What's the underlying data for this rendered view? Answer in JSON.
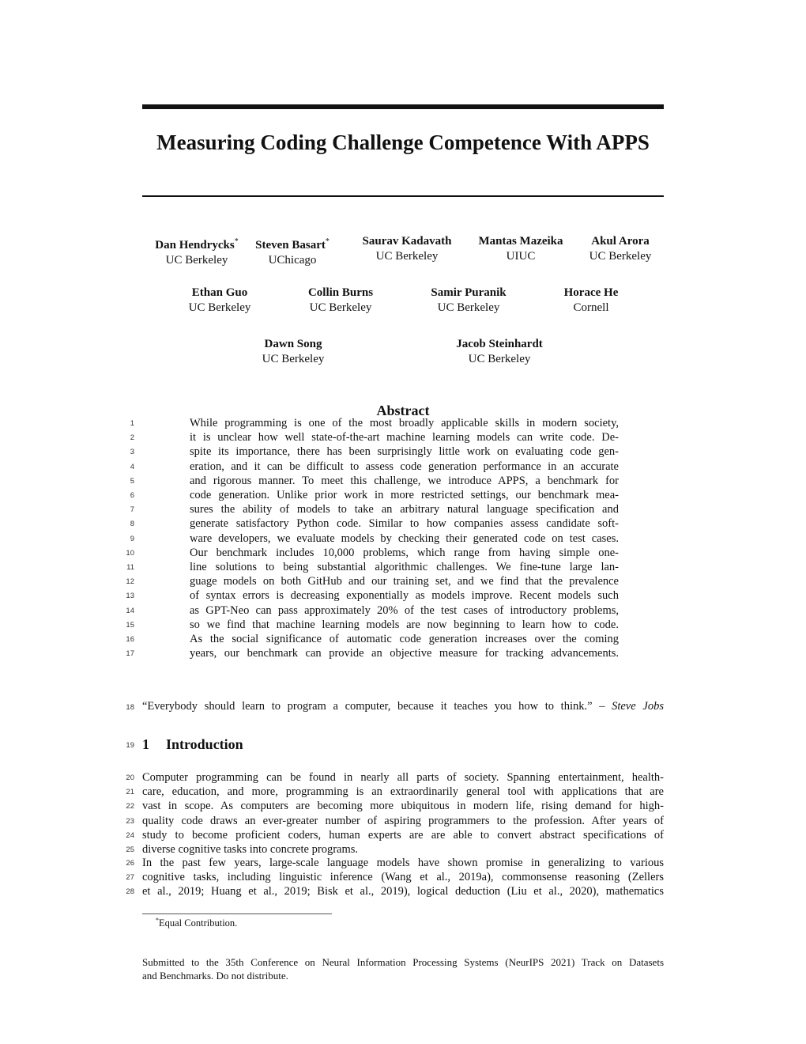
{
  "paper": {
    "title": "Measuring Coding Challenge Competence With APPS",
    "authors_row1": [
      {
        "name": "Dan Hendrycks",
        "mark": "*",
        "affiliation": "UC Berkeley"
      },
      {
        "name": "Steven Basart",
        "mark": "*",
        "affiliation": "UChicago"
      },
      {
        "name": "Saurav Kadavath",
        "mark": "",
        "affiliation": "UC Berkeley"
      },
      {
        "name": "Mantas Mazeika",
        "mark": "",
        "affiliation": "UIUC"
      },
      {
        "name": "Akul Arora",
        "mark": "",
        "affiliation": "UC Berkeley"
      }
    ],
    "authors_row2": [
      {
        "name": "Ethan Guo",
        "affiliation": "UC Berkeley"
      },
      {
        "name": "Collin Burns",
        "affiliation": "UC Berkeley"
      },
      {
        "name": "Samir Puranik",
        "affiliation": "UC Berkeley"
      },
      {
        "name": "Horace He",
        "affiliation": "Cornell"
      }
    ],
    "authors_row3": [
      {
        "name": "Dawn Song",
        "affiliation": "UC Berkeley"
      },
      {
        "name": "Jacob Steinhardt",
        "affiliation": "UC Berkeley"
      }
    ],
    "abstract_heading": "Abstract",
    "abstract_lines": [
      {
        "n": "1",
        "text": "While programming is one of the most broadly applicable skills in modern society,"
      },
      {
        "n": "2",
        "text": "it is unclear how well state-of-the-art machine learning models can write code. De-"
      },
      {
        "n": "3",
        "text": "spite its importance, there has been surprisingly little work on evaluating code gen-"
      },
      {
        "n": "4",
        "text": "eration, and it can be difficult to assess code generation performance in an accurate"
      },
      {
        "n": "5",
        "text": "and rigorous manner. To meet this challenge, we introduce APPS, a benchmark for"
      },
      {
        "n": "6",
        "text": "code generation. Unlike prior work in more restricted settings, our benchmark mea-"
      },
      {
        "n": "7",
        "text": "sures the ability of models to take an arbitrary natural language specification and"
      },
      {
        "n": "8",
        "text": "generate satisfactory Python code. Similar to how companies assess candidate soft-"
      },
      {
        "n": "9",
        "text": "ware developers, we evaluate models by checking their generated code on test cases."
      },
      {
        "n": "10",
        "text": "Our benchmark includes 10,000 problems, which range from having simple one-"
      },
      {
        "n": "11",
        "text": "line solutions to being substantial algorithmic challenges. We fine-tune large lan-"
      },
      {
        "n": "12",
        "text": "guage models on both GitHub and our training set, and we find that the prevalence"
      },
      {
        "n": "13",
        "text": "of syntax errors is decreasing exponentially as models improve. Recent models such"
      },
      {
        "n": "14",
        "text": "as GPT-Neo can pass approximately 20% of the test cases of introductory problems,"
      },
      {
        "n": "15",
        "text": "so we find that machine learning models are now beginning to learn how to code."
      },
      {
        "n": "16",
        "text": "As the social significance of automatic code generation increases over the coming"
      },
      {
        "n": "17",
        "text": "years, our benchmark can provide an objective measure for tracking advancements."
      }
    ],
    "quote": {
      "n": "18",
      "text": "“Everybody should learn to program a computer, because it teaches you how to think.” – ",
      "author": "Steve Jobs"
    },
    "section": {
      "n": "19",
      "number": "1",
      "title": "Introduction"
    },
    "intro_para1": [
      {
        "n": "20",
        "text": "Computer programming can be found in nearly all parts of society. Spanning entertainment, health-"
      },
      {
        "n": "21",
        "text": "care, education, and more, programming is an extraordinarily general tool with applications that are"
      },
      {
        "n": "22",
        "text": "vast in scope. As computers are becoming more ubiquitous in modern life, rising demand for high-"
      },
      {
        "n": "23",
        "text": "quality code draws an ever-greater number of aspiring programmers to the profession. After years of"
      },
      {
        "n": "24",
        "text": "study to become proficient coders, human experts are are able to convert abstract specifications of"
      },
      {
        "n": "25",
        "text": "diverse cognitive tasks into concrete programs."
      }
    ],
    "intro_para2": [
      {
        "n": "26",
        "text": "In the past few years, large-scale language models have shown promise in generalizing to various"
      },
      {
        "n": "27",
        "text": "cognitive tasks, including linguistic inference (Wang et al., 2019a), commonsense reasoning (Zellers"
      },
      {
        "n": "28",
        "text": "et al., 2019; Huang et al., 2019; Bisk et al., 2019), logical deduction (Liu et al., 2020), mathematics"
      }
    ],
    "footnote": {
      "mark": "*",
      "text": "Equal Contribution."
    },
    "submitted": {
      "line1": "Submitted to the 35th Conference on Neural Information Processing Systems (NeurIPS 2021) Track on Datasets",
      "line2": "and Benchmarks. Do not distribute."
    }
  }
}
